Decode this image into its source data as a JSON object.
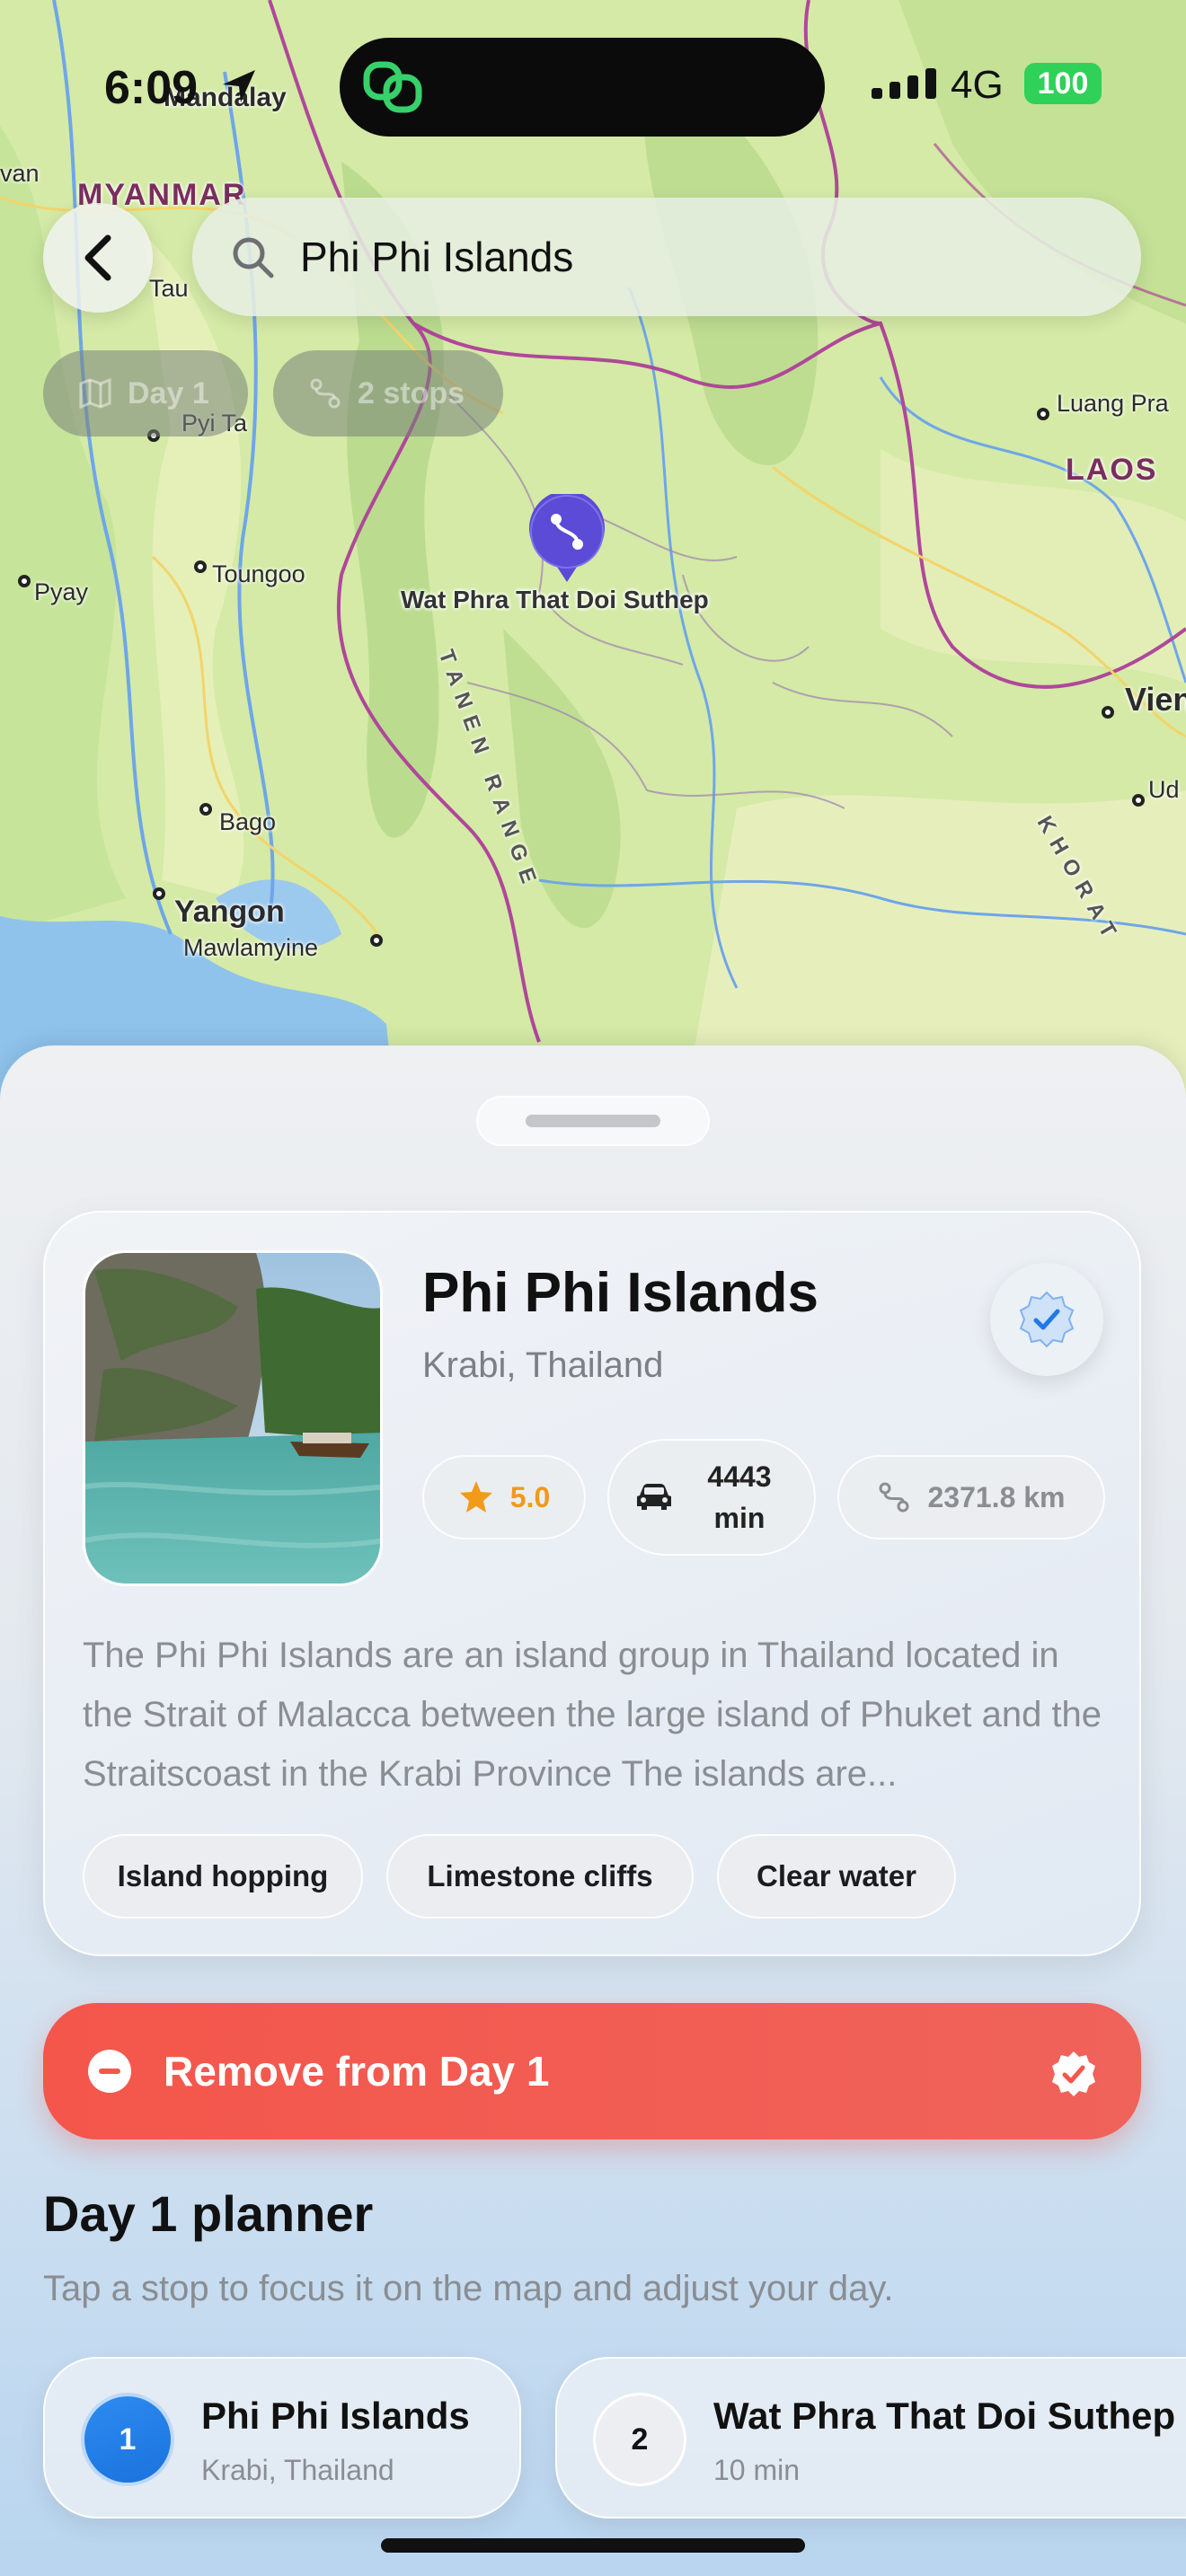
{
  "status_bar": {
    "time": "6:09",
    "network": "4G",
    "battery": "100"
  },
  "map": {
    "labels": {
      "mandalay": "Mandalay",
      "myanmar": "MYANMAR",
      "van": "van",
      "taung": "Tau",
      "pyi": "Pyi Ta",
      "luang": "Luang Pra",
      "laos": "LAOS",
      "pyay": "Pyay",
      "toungoo": "Toungoo",
      "vien": "Vien",
      "ud": "Ud",
      "bago": "Bago",
      "yangon": "Yangon",
      "mawlamyine": "Mawlamyine",
      "tanen": "TANEN RANGE",
      "khorat": "KHORAT"
    },
    "pin_label": "Wat Phra That Doi Suthep"
  },
  "search": {
    "value": "Phi Phi Islands"
  },
  "chips": {
    "day": "Day 1",
    "stops": "2 stops"
  },
  "place": {
    "title": "Phi Phi Islands",
    "subtitle": "Krabi, Thailand",
    "rating": "5.0",
    "drive_time": "4443 min",
    "distance": "2371.8 km",
    "description": "The Phi Phi Islands are an island group in Thailand located in the Strait of Malacca between the large island of Phuket and the Straitscoast in the Krabi Province The islands are...",
    "tags": [
      "Island hopping",
      "Limestone cliffs",
      "Clear water"
    ]
  },
  "remove_button": {
    "label": "Remove from Day 1"
  },
  "planner": {
    "title": "Day 1 planner",
    "hint": "Tap a stop to focus it on the map and adjust your day.",
    "stops": [
      {
        "number": "1",
        "name": "Phi Phi Islands",
        "sub": "Krabi, Thailand"
      },
      {
        "number": "2",
        "name": "Wat Phra That Doi Suthep",
        "sub": "10 min"
      }
    ]
  },
  "colors": {
    "accent_blue": "#1f7ae6",
    "destructive_red": "#f4564b",
    "rating_orange": "#f09a1a",
    "battery_green": "#2fd158",
    "pin_purple": "#5b4bd6"
  }
}
